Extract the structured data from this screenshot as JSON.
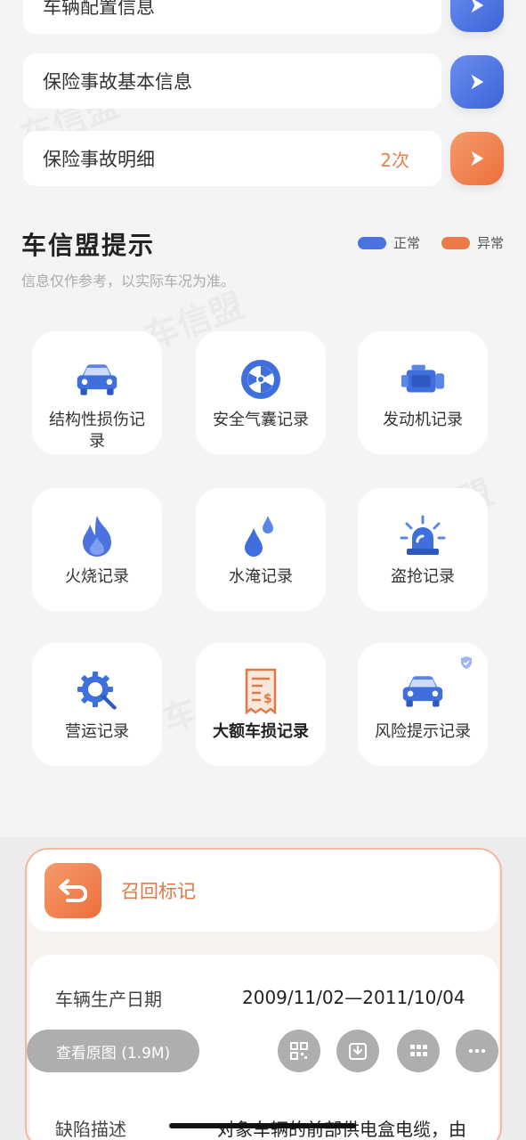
{
  "rows": [
    {
      "label": "车辆配置信息",
      "count": "",
      "tone": "blue"
    },
    {
      "label": "保险事故基本信息",
      "count": "",
      "tone": "blue"
    },
    {
      "label": "保险事故明细",
      "count": "2次",
      "tone": "orange"
    }
  ],
  "hints": {
    "title": "车信盟提示",
    "subtitle": "信息仅作参考，以实际车况为准。",
    "legend_normal": "正常",
    "legend_abnormal": "异常",
    "normal_color": "#4a72e0",
    "abnormal_color": "#ec7a48"
  },
  "tiles": [
    {
      "label": "结构性损伤记录",
      "icon": "car-icon"
    },
    {
      "label": "安全气囊记录",
      "icon": "airbag-icon"
    },
    {
      "label": "发动机记录",
      "icon": "engine-icon"
    },
    {
      "label": "火烧记录",
      "icon": "fire-icon"
    },
    {
      "label": "水淹记录",
      "icon": "water-drops-icon"
    },
    {
      "label": "盗抢记录",
      "icon": "alarm-light-icon"
    },
    {
      "label": "营运记录",
      "icon": "gear-wrench-icon"
    },
    {
      "label": "大额车损记录",
      "icon": "receipt-icon"
    },
    {
      "label": "风险提示记录",
      "icon": "car-icon"
    }
  ],
  "recall": {
    "title": "召回标记",
    "production_date_label": "车辆生产日期",
    "production_date_value": "2009/11/02—2011/10/04",
    "defect_label": "缺陷描述",
    "defect_value": "对象车辆的前部供电盒电缆，由"
  },
  "viewer": {
    "view_original": "查看原图 (1.9M)"
  }
}
